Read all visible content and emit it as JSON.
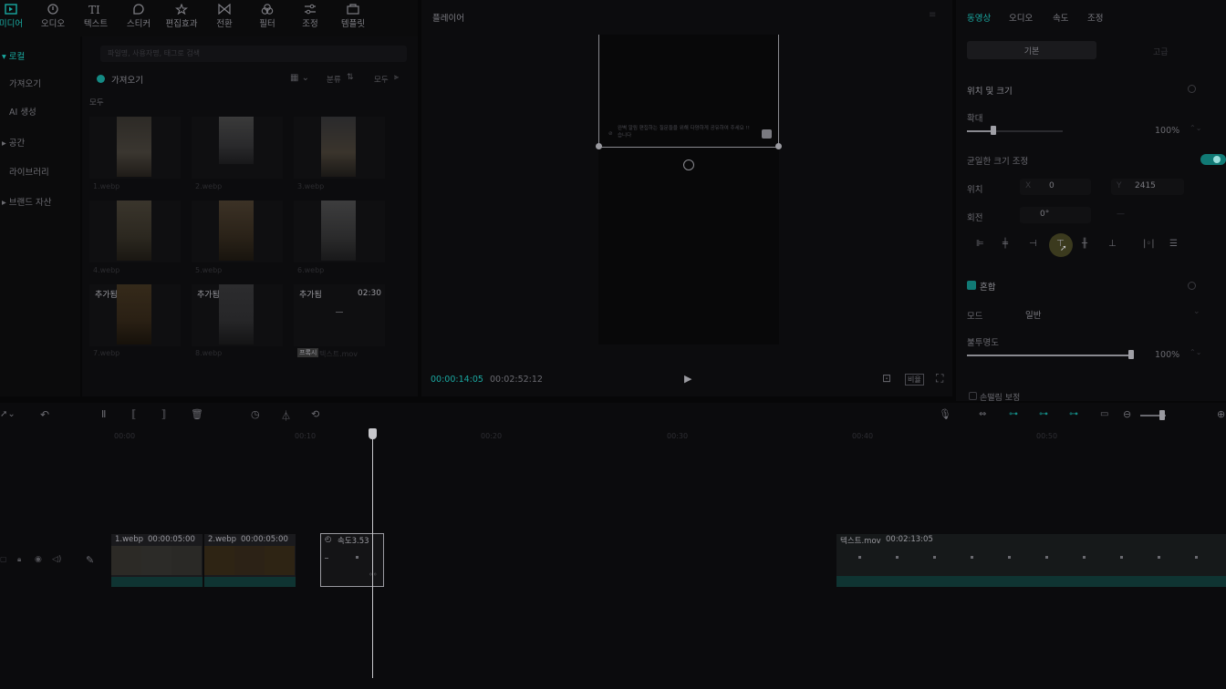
{
  "toolbar": {
    "items": [
      {
        "label": "미디어",
        "icon": "media-icon"
      },
      {
        "label": "오디오",
        "icon": "audio-icon"
      },
      {
        "label": "텍스트",
        "icon": "text-icon"
      },
      {
        "label": "스티커",
        "icon": "sticker-icon"
      },
      {
        "label": "편집효과",
        "icon": "effects-icon"
      },
      {
        "label": "전환",
        "icon": "transition-icon"
      },
      {
        "label": "필터",
        "icon": "filter-icon"
      },
      {
        "label": "조정",
        "icon": "adjust-icon"
      },
      {
        "label": "템플릿",
        "icon": "template-icon"
      }
    ]
  },
  "leftnav": {
    "items": [
      "▾ 로컬",
      "가져오기",
      "AI 생성",
      "▸ 공간",
      "라이브러리",
      "▸ 브랜드 자산"
    ]
  },
  "media": {
    "search_placeholder": "파일명, 사용자명, 태그로 검색",
    "import_label": "가져오기",
    "sort_label": "분류",
    "filter_label": "모두",
    "section_label": "모두",
    "thumbs": [
      {
        "name": "1.webp",
        "tag": ""
      },
      {
        "name": "2.webp",
        "tag": ""
      },
      {
        "name": "3.webp",
        "tag": ""
      },
      {
        "name": "4.webp",
        "tag": ""
      },
      {
        "name": "5.webp",
        "tag": ""
      },
      {
        "name": "6.webp",
        "tag": ""
      },
      {
        "name": "7.webp",
        "tag": "추가됨"
      },
      {
        "name": "8.webp",
        "tag": "추가됨"
      },
      {
        "name": "텍스트.mov",
        "tag": "추가됨",
        "duration": "02:30",
        "badge": "프록시"
      }
    ]
  },
  "player": {
    "title": "플레이어",
    "caption": "완벽 알림 편집하는 질문들을 위해 다양하게 공유하여 주세요 !!",
    "caption2": "습니다",
    "time_current": "00:00:14:05",
    "time_total": "00:02:52:12",
    "ratio_label": "비율"
  },
  "props": {
    "tabs": [
      "동영상",
      "오디오",
      "속도",
      "조정"
    ],
    "subtabs": [
      "기본",
      "고급"
    ],
    "section_position": "위치 및 크기",
    "scale_label": "확대",
    "scale_value": "100%",
    "scale_fraction": 0.28,
    "uniform_label": "균일한 크기 조정",
    "position_label": "위치",
    "x_label": "X",
    "x_value": "0",
    "y_label": "Y",
    "y_value": "2415",
    "rotate_label": "회전",
    "rotate_value": "0°",
    "blend_label": "혼합",
    "mode_label": "모드",
    "mode_value": "일반",
    "opacity_label": "불투명도",
    "opacity_value": "100%",
    "opacity_fraction": 1.0,
    "stabilize_label": "손떨림 보정"
  },
  "timeline": {
    "ruler": [
      "00:00",
      "00:10",
      "00:20",
      "00:30",
      "00:40",
      "00:50"
    ],
    "clips": [
      {
        "label": "1.webp",
        "duration": "00:00:05:00"
      },
      {
        "label": "2.webp",
        "duration": "00:00:05:00"
      },
      {
        "label": "속도3.53",
        "duration": ""
      },
      {
        "label": "텍스트.mov",
        "duration": "00:02:13:05"
      }
    ]
  }
}
